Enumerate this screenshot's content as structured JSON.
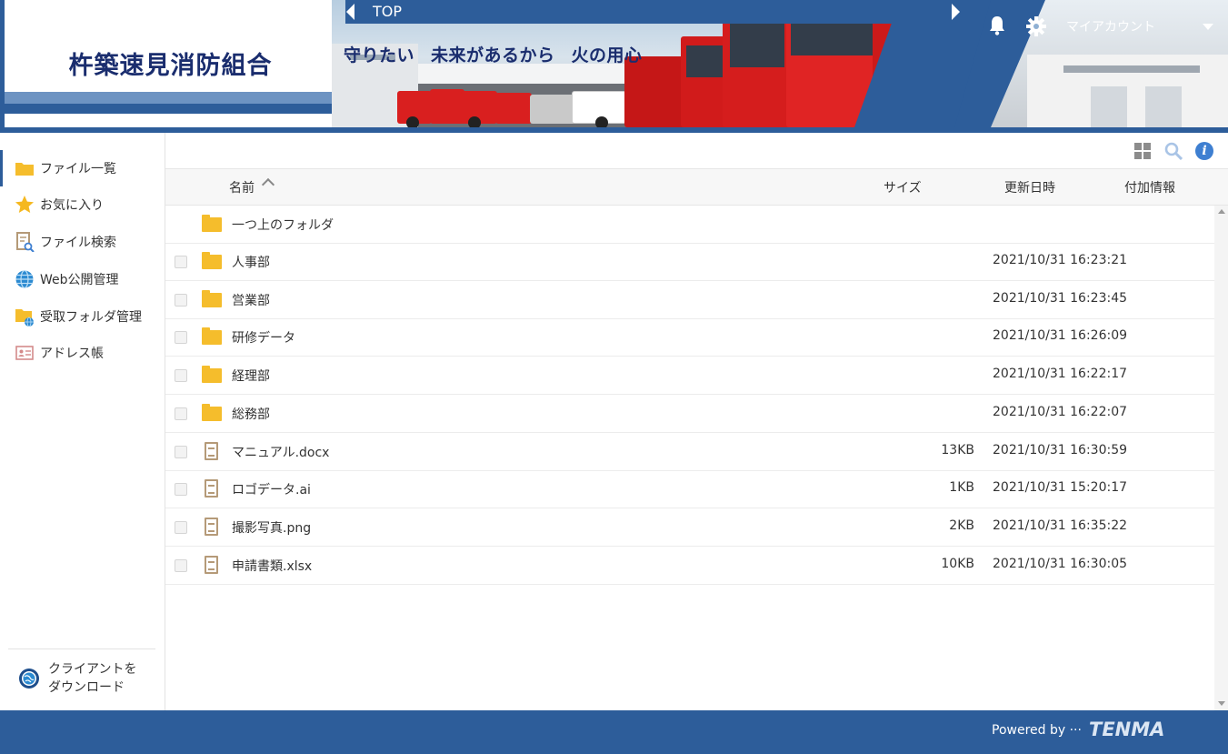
{
  "header": {
    "logo_title": "杵築速見消防組合",
    "breadcrumb": "TOP",
    "slogan": [
      "守りたい",
      "未来があるから",
      "火の用心"
    ],
    "account_label": "マイアカウント"
  },
  "sidebar": {
    "items": [
      {
        "label": "ファイル一覧",
        "icon": "folder-icon"
      },
      {
        "label": "お気に入り",
        "icon": "star-icon"
      },
      {
        "label": "ファイル検索",
        "icon": "file-search-icon"
      },
      {
        "label": "Web公開管理",
        "icon": "globe-icon"
      },
      {
        "label": "受取フォルダ管理",
        "icon": "folder-globe-icon"
      },
      {
        "label": "アドレス帳",
        "icon": "address-card-icon"
      }
    ],
    "client_download": [
      "クライアントを",
      "ダウンロード"
    ]
  },
  "table": {
    "columns": {
      "name": "名前",
      "size": "サイズ",
      "modified": "更新日時",
      "extra": "付加情報"
    },
    "parent_folder": "一つ上のフォルダ",
    "rows": [
      {
        "name": "人事部",
        "type": "folder",
        "size": "",
        "modified": "2021/10/31 16:23:21"
      },
      {
        "name": "営業部",
        "type": "folder",
        "size": "",
        "modified": "2021/10/31 16:23:45"
      },
      {
        "name": "研修データ",
        "type": "folder",
        "size": "",
        "modified": "2021/10/31 16:26:09"
      },
      {
        "name": "経理部",
        "type": "folder",
        "size": "",
        "modified": "2021/10/31 16:22:17"
      },
      {
        "name": "総務部",
        "type": "folder",
        "size": "",
        "modified": "2021/10/31 16:22:07"
      },
      {
        "name": "マニュアル.docx",
        "type": "file",
        "size": "13KB",
        "modified": "2021/10/31 16:30:59"
      },
      {
        "name": "ロゴデータ.ai",
        "type": "file",
        "size": "1KB",
        "modified": "2021/10/31 15:20:17"
      },
      {
        "name": "撮影写真.png",
        "type": "file",
        "size": "2KB",
        "modified": "2021/10/31 16:35:22"
      },
      {
        "name": "申請書類.xlsx",
        "type": "file",
        "size": "10KB",
        "modified": "2021/10/31 16:30:05"
      }
    ]
  },
  "footer": {
    "powered_by": "Powered by ···",
    "brand": "TENMA"
  },
  "colors": {
    "primary": "#2d5d9a",
    "logo_text": "#1a2d6e",
    "folder": "#f5bd2c",
    "info": "#3e7fd1"
  }
}
